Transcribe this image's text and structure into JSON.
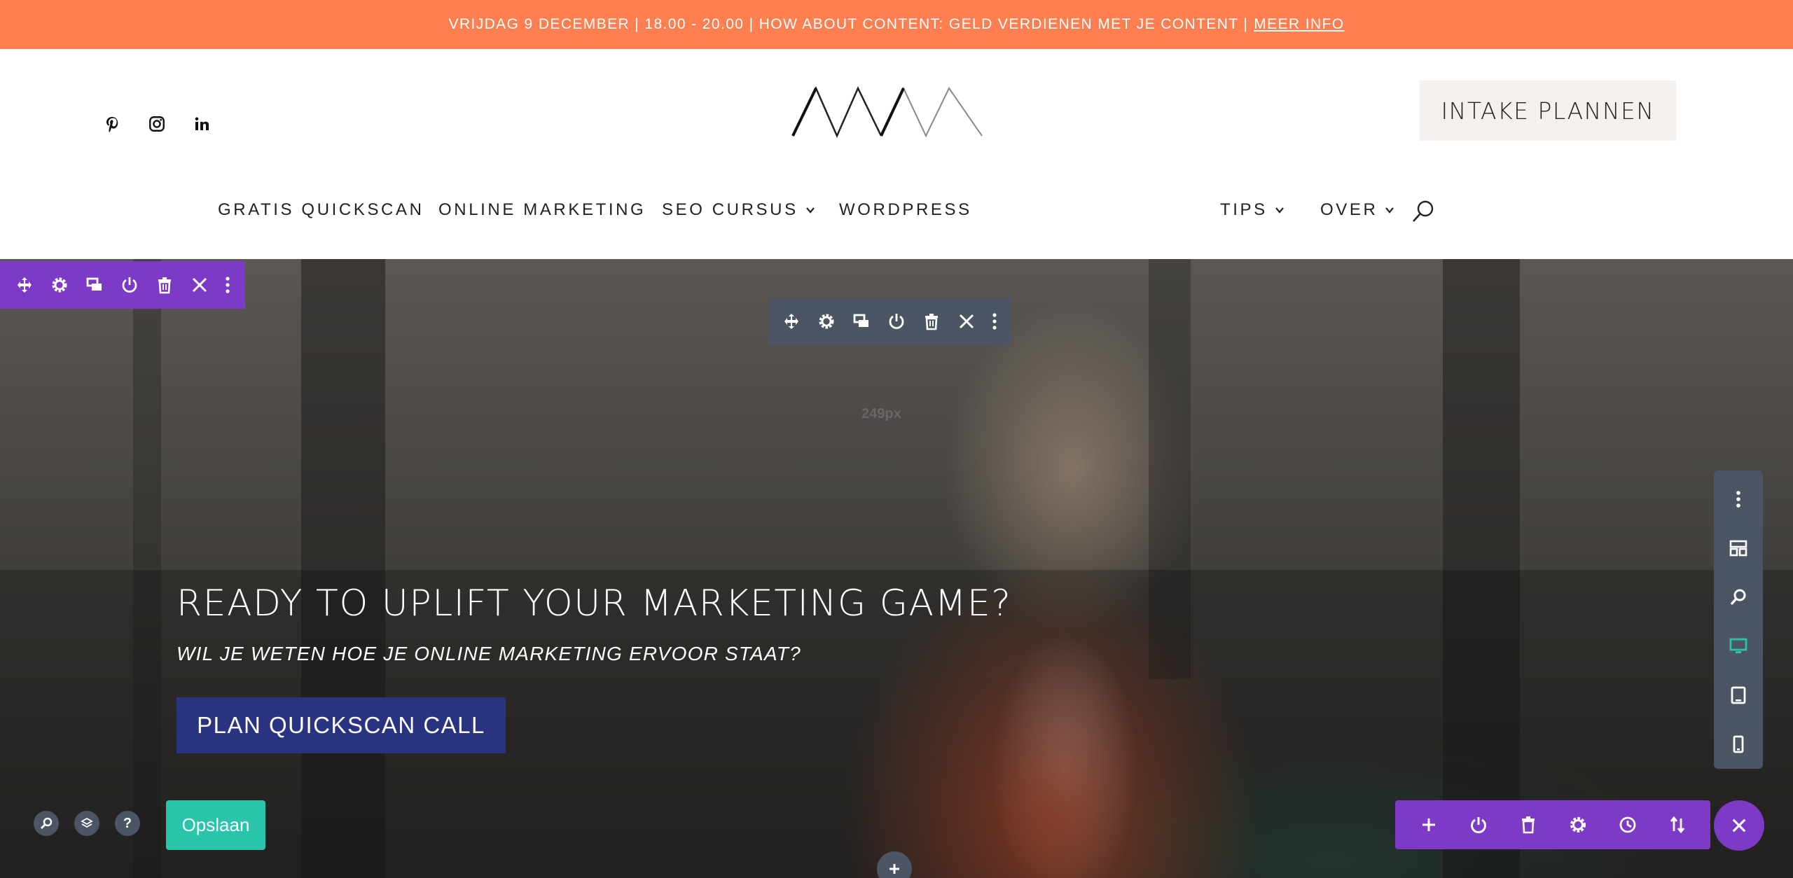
{
  "announcement": {
    "text": "VRIJDAG 9 DECEMBER | 18.00 - 20.00 | HOW ABOUT CONTENT: GELD VERDIENEN MET JE CONTENT |",
    "link": "MEER INFO"
  },
  "header": {
    "socials": [
      "pinterest-icon",
      "instagram-icon",
      "linkedin-icon"
    ],
    "cta": "INTAKE PLANNEN"
  },
  "nav": {
    "items": [
      {
        "label": "GRATIS QUICKSCAN"
      },
      {
        "label": "ONLINE MARKETING"
      },
      {
        "label": "SEO CURSUS"
      },
      {
        "label": "WORDPRESS"
      },
      {
        "label": "TIPS"
      },
      {
        "label": "OVER"
      }
    ]
  },
  "hero": {
    "title": "READY TO UPLIFT YOUR MARKETING GAME?",
    "subtitle": "WIL JE WETEN HOE JE ONLINE MARKETING ERVOOR STAAT?",
    "button": "PLAN QUICKSCAN CALL",
    "spacing_label": "249px"
  },
  "builder": {
    "save_label": "Opslaan",
    "help_label": "?",
    "colors": {
      "purple": "#7c3ac6",
      "gray": "#4b5563",
      "teal": "#29c4a9",
      "orange": "#ff7f50",
      "navy": "#2a3282"
    }
  }
}
